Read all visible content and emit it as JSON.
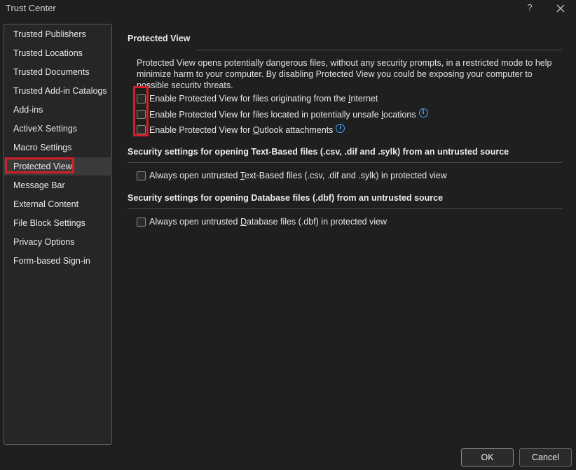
{
  "window": {
    "title": "Trust Center",
    "help_label": "?"
  },
  "sidebar": {
    "items": [
      {
        "label": "Trusted Publishers"
      },
      {
        "label": "Trusted Locations"
      },
      {
        "label": "Trusted Documents"
      },
      {
        "label": "Trusted Add-in Catalogs"
      },
      {
        "label": "Add-ins"
      },
      {
        "label": "ActiveX Settings"
      },
      {
        "label": "Macro Settings"
      },
      {
        "label": "Protected View"
      },
      {
        "label": "Message Bar"
      },
      {
        "label": "External Content"
      },
      {
        "label": "File Block Settings"
      },
      {
        "label": "Privacy Options"
      },
      {
        "label": "Form-based Sign-in"
      }
    ],
    "selected": "Protected View"
  },
  "protected_view": {
    "heading": "Protected View",
    "description": "Protected View opens potentially dangerous files, without any security prompts, in a restricted mode to help minimize harm to your computer. By disabling Protected View you could be exposing your computer to possible security threats.",
    "options": [
      {
        "pre": "Enable Protected View for files originating from the ",
        "key": "I",
        "post": "nternet",
        "checked": false
      },
      {
        "pre": "Enable Protected View for files located in potentially unsafe ",
        "key": "l",
        "post": "ocations",
        "checked": false
      },
      {
        "pre": "Enable Protected View for ",
        "key": "O",
        "post": "utlook attachments",
        "checked": false
      }
    ]
  },
  "text_based": {
    "heading": "Security settings for opening Text-Based files (.csv, .dif and .sylk) from an untrusted source",
    "option": {
      "pre": "Always open untrusted ",
      "key": "T",
      "post": "ext-Based files (.csv, .dif and .sylk) in protected view",
      "checked": false
    }
  },
  "database": {
    "heading": "Security settings for opening Database files (.dbf) from an untrusted source",
    "option": {
      "pre": "Always open untrusted ",
      "key": "D",
      "post": "atabase files (.dbf) in protected view",
      "checked": false
    }
  },
  "buttons": {
    "ok": "OK",
    "cancel": "Cancel"
  },
  "colors": {
    "background": "#1f1f1f",
    "highlight": "#d11f25",
    "info": "#4aa3ff"
  }
}
